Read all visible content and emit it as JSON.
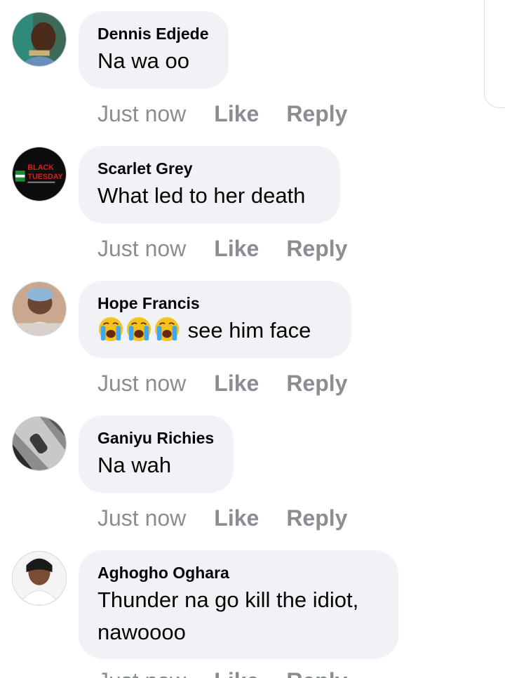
{
  "comments": [
    {
      "author": "Dennis Edjede",
      "text": "Na wa oo",
      "time": "Just now",
      "like_label": "Like",
      "reply_label": "Reply",
      "avatar": "man-portrait"
    },
    {
      "author": "Scarlet Grey",
      "text": "What led to her death",
      "time": "Just now",
      "like_label": "Like",
      "reply_label": "Reply",
      "avatar": "black-tuesday-poster",
      "avatar_text": [
        "BLACK",
        "TUESDAY"
      ]
    },
    {
      "author": "Hope Francis",
      "emoji": [
        "crying-face",
        "crying-face",
        "crying-face"
      ],
      "text": "see him face",
      "time": "Just now",
      "like_label": "Like",
      "reply_label": "Reply",
      "avatar": "baby-photo"
    },
    {
      "author": "Ganiyu Richies",
      "text": "Na wah",
      "time": "Just now",
      "like_label": "Like",
      "reply_label": "Reply",
      "avatar": "monochrome-photo"
    },
    {
      "author": "Aghogho Oghara",
      "text_line1": "Thunder na go kill the idiot,",
      "text_line2": "nawoooo",
      "time": "Just now",
      "like_label": "Like",
      "reply_label": "Reply",
      "avatar": "woman-portrait"
    }
  ],
  "colors": {
    "bubble": "#f0f2f5",
    "meta": "#8a8d91",
    "text": "#050505"
  }
}
